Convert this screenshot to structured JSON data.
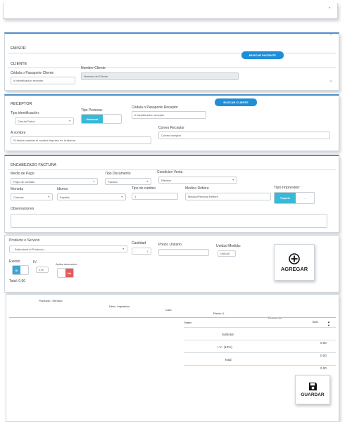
{
  "emisor": {
    "title": "EMISOR"
  },
  "cliente": {
    "title": "CLIENTE",
    "buscar_button": "BUSCAR PACIENTE",
    "cedula_label": "Cédula o Pasaporte Cliente",
    "cedula_placeholder": "# Identificación receptor",
    "nombre_label": "Nombre Cliente",
    "nombre_placeholder": "Nombre del Cliente"
  },
  "receptor": {
    "title": "RECEPTOR",
    "buscar_button": "BUSCAR CLIENTE",
    "tipo_id_label": "Tipo identificación:",
    "tipo_id_value": "Cédula Física",
    "tipo_persona_label": "Tipo Persona:",
    "tipo_persona_on": "Nacional",
    "cedula_label": "Cédula o Pasaporte Receptor",
    "cedula_placeholder": "# Identificación receptor",
    "nombre_label": "A nombre",
    "nombre_placeholder": "Si desea cambiar el nombre impreso en la factura",
    "correo_label": "Correo Receptor",
    "correo_placeholder": "Correo receptor"
  },
  "encabezado": {
    "title": "ENCABEZADO FACTURA",
    "medio_pago_label": "Medio de Pago",
    "medio_pago_value": "Pago de contado",
    "tipo_doc_label": "Tipo Documento",
    "tipo_doc_value": "Factura",
    "condicion_label": "Condicion Venta",
    "condicion_value": "Efectivo",
    "moneda_label": "Moneda",
    "moneda_value": "Colones",
    "idioma_label": "Idioma",
    "idioma_value": "España",
    "tipo_cambio_label": "Tipo de cambio",
    "tipo_cambio_value": "1",
    "medico_label": "Medico Refiere",
    "medico_placeholder": "Medico/Persona Refiere",
    "tipo_impresion_label": "Tipo Impresión:",
    "tipo_impresion_on": "Tiquete",
    "observaciones_label": "Observaciones"
  },
  "producto": {
    "label": "Producto o Servicio",
    "select_value": "-- Seleccione el Producto --",
    "cantidad_label": "Cantidad",
    "cantidad_value": "1",
    "precio_label": "Precio Unitario",
    "unidad_label": "Unidad Medida:",
    "unidad_value": "UNIDAD",
    "exento_label": "Exento",
    "exento_value": "Si",
    "iv_label": "IV:",
    "iv_value": "0.00",
    "aplica_label": "Aplica descuento",
    "aplica_value": "No",
    "total_label": "Total:",
    "total_value": "0.00",
    "agregar_button": "AGREGAR"
  },
  "tabla": {
    "headers": [
      "Producto / Servicio",
      "Desc. Impresión",
      "Cant.",
      "Precio U.",
      "Descuento",
      "Total"
    ],
    "totales_label": "Totales",
    "subtotal_label": "Subtotal:",
    "iv_label": "I.V.: (13%)",
    "total_label": "Total:",
    "values": [
      "0.00",
      "0.00",
      "0.00"
    ],
    "guardar_button": "GUARDAR"
  }
}
